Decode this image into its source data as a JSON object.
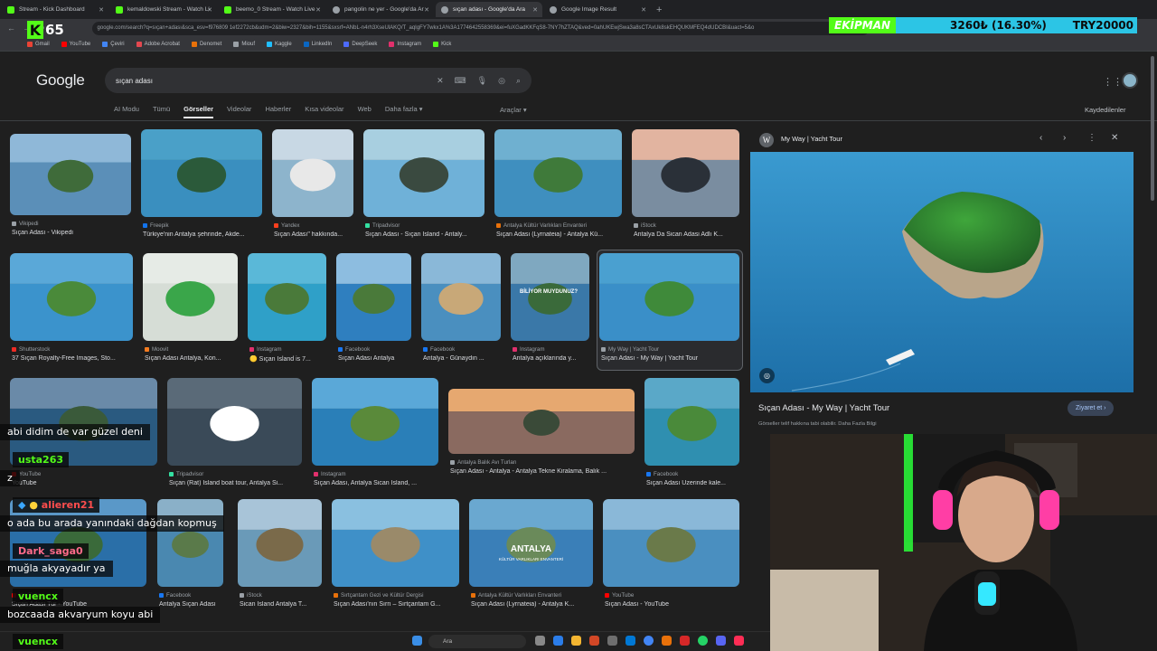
{
  "browser": {
    "tabs": [
      {
        "label": "Stream - Kick Dashboard",
        "color": "#53fc18",
        "active": false
      },
      {
        "label": "kemaldowski Stream - Watch Li",
        "color": "#53fc18",
        "active": false
      },
      {
        "label": "beemo_0 Stream - Watch Live",
        "color": "#53fc18",
        "active": false
      },
      {
        "label": "pangolin ne yer - Google'da Ar",
        "color": "#9aa0a6",
        "active": false
      },
      {
        "label": "sıçan adası - Google'da Ara",
        "color": "#9aa0a6",
        "active": true
      },
      {
        "label": "Google Image Result",
        "color": "#9aa0a6",
        "active": false
      }
    ],
    "new_tab": "+",
    "url": "google.com/search?q=sıçan+adası&sca_esv=f976809 1ef2272cb&udm=2&biw=2327&bih=1155&sxsrf=ANbL-n4rh3XseUlAKQ/T_aqIgFY7wkx1A%3A1774642558369&ei=fuXGadKKFqS8-7NY7hZTAQ&ved=0ahUKEwjSwa3a8sCTAxUk8skEHQUKMFEQ4dUDCBI&uact=5&o",
    "back": "←",
    "forward": "→",
    "reload": "↻",
    "bookmarks": [
      {
        "label": "Gmail",
        "color": "#ea4335"
      },
      {
        "label": "YouTube",
        "color": "#ff0000"
      },
      {
        "label": "Çeviri",
        "color": "#4285f4"
      },
      {
        "label": "Adobe Acrobat",
        "color": "#e34850"
      },
      {
        "label": "Denomet",
        "color": "#e8710a"
      },
      {
        "label": "Miouf",
        "color": "#9aa0a6"
      },
      {
        "label": "Kaggle",
        "color": "#20beff"
      },
      {
        "label": "LinkedIn",
        "color": "#0a66c2"
      },
      {
        "label": "DeepSeek",
        "color": "#4d6bfe"
      },
      {
        "label": "Instagram",
        "color": "#e1306c"
      },
      {
        "label": "Kick",
        "color": "#53fc18"
      }
    ]
  },
  "overlay": {
    "kick_logo": "K",
    "viewer_count": "65",
    "ticker_label": "EKİPMAN",
    "ticker_value": "3260₺ (16.30%)",
    "ticker_goal": "TRY20000"
  },
  "google": {
    "logo": "Google",
    "query": "sıçan adası",
    "clear_icon": "✕",
    "keyboard_icon": "⌨",
    "mic_icon": "🎙",
    "lens_icon": "◎",
    "search_icon": "⌕",
    "apps_icon": "⋮⋮",
    "tabs": [
      "AI Modu",
      "Tümü",
      "Görseller",
      "Videolar",
      "Haberler",
      "Kısa videolar",
      "Web",
      "Daha fazla ▾"
    ],
    "active_tab_index": 2,
    "tools": "Araçlar ▾",
    "saved": "Kaydedilenler"
  },
  "results": [
    {
      "source": "Vikipedi",
      "title": "Sıçan Adası - Vikipedi",
      "color": "#9aa0a6"
    },
    {
      "source": "Freepik",
      "title": "Türkiye'nin Antalya şehrinde, Akde...",
      "color": "#1273eb"
    },
    {
      "source": "Yandex",
      "title": "Sıçan Adası\" hakkında...",
      "color": "#fc3f1d"
    },
    {
      "source": "Tripadvisor",
      "title": "Sıçan Adası - Sıçan Island - Antaly...",
      "color": "#34e0a1"
    },
    {
      "source": "Antalya Kültür Varlıkları Envanteri",
      "title": "Sıçan Adası (Lyrnateia) - Antalya Kü...",
      "color": "#e8710a"
    },
    {
      "source": "iStock",
      "title": "Antalya Da Sican Adasi Adlı K...",
      "color": "#9aa0a6"
    },
    {
      "source": "Shutterstock",
      "title": "37 Sıçan Royalty-Free Images, Sto...",
      "color": "#ee2b24"
    },
    {
      "source": "Moovit",
      "title": "Sıçan Adası Antalya, Kon...",
      "color": "#f47b20"
    },
    {
      "source": "Instagram",
      "title": "🟡 Sıçan Island is 7...",
      "color": "#e1306c"
    },
    {
      "source": "Facebook",
      "title": "Sıçan Adası Antalya",
      "color": "#1877f2"
    },
    {
      "source": "Facebook",
      "title": "Antalya - Günaydın ...",
      "color": "#1877f2"
    },
    {
      "source": "Instagram",
      "title": "Antalya açıklarında y...",
      "color": "#e1306c"
    },
    {
      "source": "My Way | Yacht Tour",
      "title": "Sıçan Adası - My Way | Yacht Tour",
      "color": "#9aa0a6"
    },
    {
      "source": "YouTube",
      "title": "YouTube",
      "color": "#ff0000"
    },
    {
      "source": "Tripadvisor",
      "title": "Sıçan (Rat) Island boat tour, Antalya Si...",
      "color": "#34e0a1"
    },
    {
      "source": "Instagram",
      "title": "Sıçan Adası, Antalya Sican Island, ...",
      "color": "#e1306c"
    },
    {
      "source": "Antalya Balık Avı Turları",
      "title": "Sıçan Adası - Antalya - Antalya Tekne Kiralama, Balık ...",
      "color": "#9aa0a6"
    },
    {
      "source": "Facebook",
      "title": "Sıçan Adası Üzerinde kale...",
      "color": "#1877f2"
    },
    {
      "source": "YouTube",
      "title": "Sıçan Adası Tur - YouTube",
      "color": "#ff0000"
    },
    {
      "source": "Facebook",
      "title": "Antalya Sıçan Adası",
      "color": "#1877f2"
    },
    {
      "source": "iStock",
      "title": "Sican Island Antalya T...",
      "color": "#9aa0a6"
    },
    {
      "source": "Sırtçantam Gezi ve Kültür Dergisi",
      "title": "Sıçan Adası'nın Sırrı – Sırtçantam G...",
      "color": "#e8710a"
    },
    {
      "source": "Antalya Kültür Varlıkları Envanteri",
      "title": "Sıçan Adası (Lyrnateia) - Antalya K...",
      "color": "#e8710a"
    },
    {
      "source": "YouTube",
      "title": "Sıçan Adası - YouTube",
      "color": "#ff0000"
    }
  ],
  "thumb_text": {
    "biliyor": "BİLİYOR MUYDUNUZ?",
    "antalya": "ANTALYA",
    "antalya_sub": "KÜLTÜR VARLIKLARI ENVANTERİ"
  },
  "panel": {
    "site_icon": "W",
    "site": "My Way | Yacht Tour",
    "prev_icon": "‹",
    "next_icon": "›",
    "more_icon": "⋮",
    "close_icon": "✕",
    "caption": "Sıçan Adası - My Way | Yacht Tour",
    "visit": "Ziyaret et ›",
    "note": "Görseller telif hakkına tabi olabilir. Daha Fazla Bilgi"
  },
  "chat": [
    {
      "kind": "msg",
      "text": "abi didim de var güzel deni"
    },
    {
      "kind": "user",
      "text": "usta263",
      "color": "#53fc18"
    },
    {
      "kind": "msg",
      "text": "z"
    },
    {
      "kind": "user",
      "text": "alieren21",
      "color": "#ff4d4d"
    },
    {
      "kind": "msg",
      "text": "o ada bu arada yanındaki dağdan kopmuş"
    },
    {
      "kind": "user",
      "text": "Dark_saga0",
      "color": "#ff6b8a"
    },
    {
      "kind": "msg",
      "text": "muğla akyayadır ya"
    },
    {
      "kind": "user",
      "text": "vuencx",
      "color": "#53fc18"
    },
    {
      "kind": "msg",
      "text": "bozcaada akvaryum koyu abi"
    },
    {
      "kind": "user",
      "text": "vuencx",
      "color": "#53fc18"
    }
  ],
  "taskbar": {
    "search_placeholder": "Ara"
  }
}
